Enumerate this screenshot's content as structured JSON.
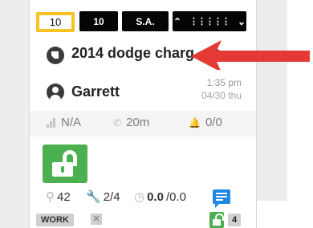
{
  "toolbar": {
    "tabs": [
      {
        "label": "10",
        "active": true
      },
      {
        "label": "10",
        "active": false
      },
      {
        "label": "S.A.",
        "active": false
      }
    ],
    "menu_icons": [
      "chevron-up-icon",
      "dot-grid-icon",
      "chevron-down-icon"
    ]
  },
  "vehicle": {
    "title": "2014 dodge charg",
    "icon": "tag-icon",
    "action_icon": "plus-circle-icon"
  },
  "driver": {
    "name": "Garrett",
    "time": "1:35 pm",
    "date": "04/30 thu"
  },
  "stats": {
    "signal": "N/A",
    "duration": "20m",
    "alerts": "0/0"
  },
  "lock": {
    "state": "unlocked",
    "color": "#4cb050"
  },
  "metrics": {
    "search_count": "42",
    "tools": "2/4",
    "odometer_value": "0.0",
    "odometer_total": "/0.0"
  },
  "footer": {
    "work_label": "WORK",
    "count": "4"
  },
  "colors": {
    "active_tab_border": "#f6c324",
    "toolbar_bg": "#050505",
    "lock_green": "#4cb050",
    "chat_blue": "#1e88e5",
    "annotation_arrow": "#e53935"
  }
}
